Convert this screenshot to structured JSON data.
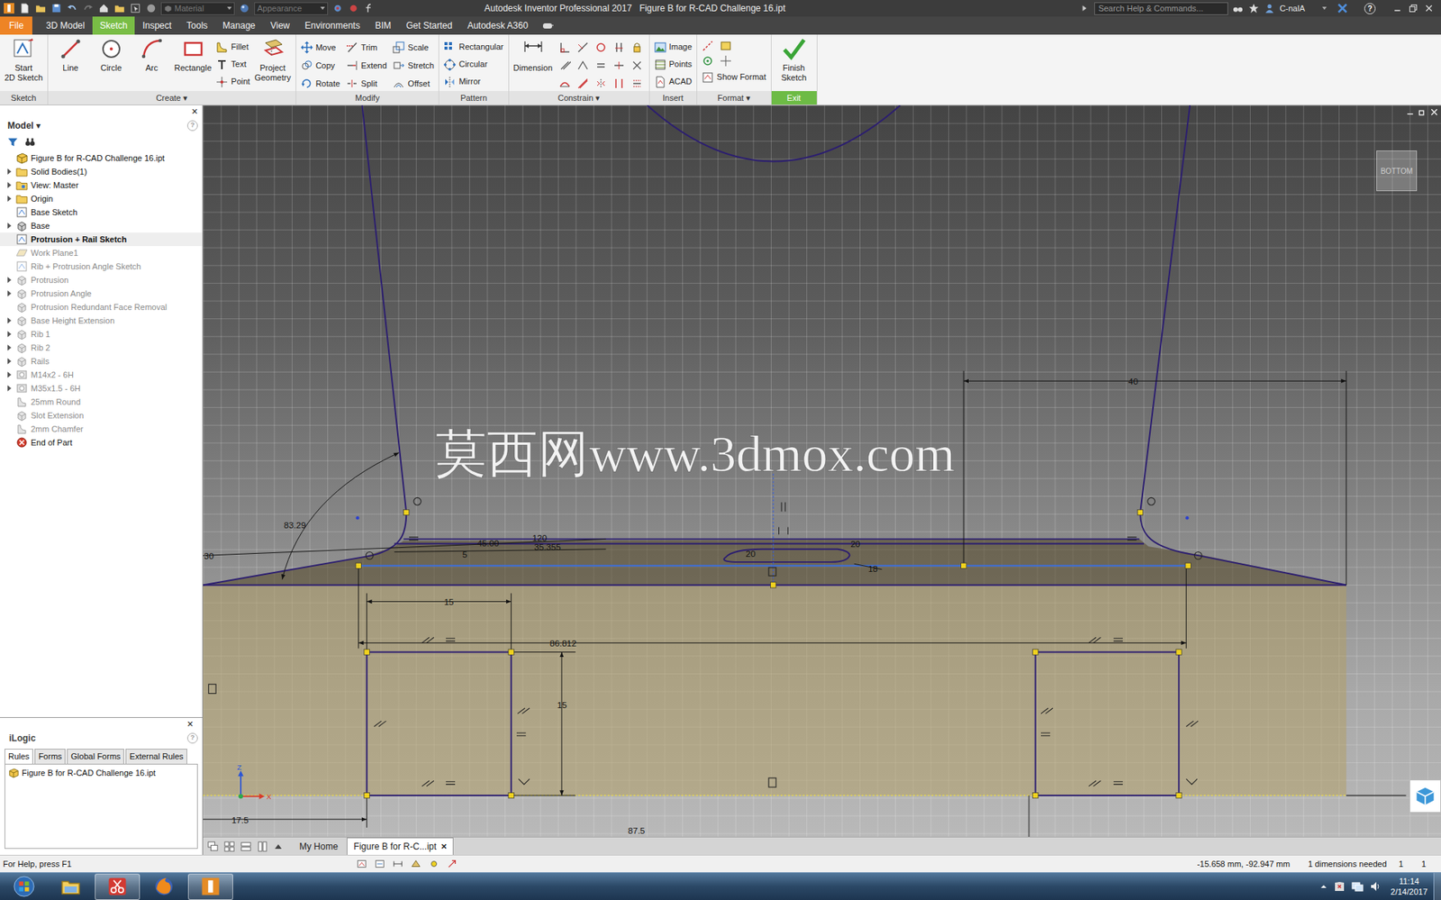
{
  "title_bar": {
    "material": {
      "label": "Material",
      "disabled": true
    },
    "appearance": {
      "label": "Appearance",
      "disabled": true
    },
    "title": "Autodesk Inventor Professional 2017   Figure B for R-CAD Challenge 16.ipt",
    "search": {
      "placeholder": "Search Help & Commands..."
    },
    "user": "C-nalA",
    "help": "?"
  },
  "ribbon_tabs": [
    {
      "label": "File",
      "kind": "file",
      "selected": false
    },
    {
      "label": "3D Model",
      "kind": "tab",
      "selected": false
    },
    {
      "label": "Sketch",
      "kind": "tab",
      "selected": true
    },
    {
      "label": "Inspect",
      "kind": "tab",
      "selected": false
    },
    {
      "label": "Tools",
      "kind": "tab",
      "selected": false
    },
    {
      "label": "Manage",
      "kind": "tab",
      "selected": false
    },
    {
      "label": "View",
      "kind": "tab",
      "selected": false
    },
    {
      "label": "Environments",
      "kind": "tab",
      "selected": false
    },
    {
      "label": "BIM",
      "kind": "tab",
      "selected": false
    },
    {
      "label": "Get Started",
      "kind": "tab",
      "selected": false
    },
    {
      "label": "Autodesk A360",
      "kind": "tab",
      "selected": false
    }
  ],
  "ribbon": {
    "sketch": {
      "label": "Sketch",
      "start": [
        "Start",
        "2D Sketch"
      ]
    },
    "create": {
      "label": "Create ▾",
      "large": [
        "Line",
        "Circle",
        "Arc",
        "Rectangle"
      ],
      "small": [
        "Fillet",
        "Text",
        "Point"
      ],
      "project": [
        "Project",
        "Geometry"
      ]
    },
    "modify": {
      "label": "Modify",
      "tools": [
        "Move",
        "Trim",
        "Scale",
        "Copy",
        "Extend",
        "Stretch",
        "Rotate",
        "Split",
        "Offset"
      ]
    },
    "pattern": {
      "label": "Pattern",
      "tools": [
        "Rectangular",
        "Circular",
        "Mirror"
      ]
    },
    "constrain": {
      "label": "Constrain ▾",
      "dimension": "Dimension"
    },
    "insert": {
      "label": "Insert",
      "tools": [
        "Image",
        "Points",
        "ACAD"
      ]
    },
    "format": {
      "label": "Format ▾",
      "show_format": "Show Format"
    },
    "exit": {
      "label": "Exit",
      "finish": [
        "Finish",
        "Sketch"
      ]
    }
  },
  "browser": {
    "close": "×",
    "title": "Model ▾",
    "help": "?",
    "items": [
      {
        "label": "Figure B for R-CAD Challenge 16.ipt",
        "kind": "part",
        "expandable": false,
        "active": false,
        "dimmed": false
      },
      {
        "label": "Solid Bodies(1)",
        "kind": "folder",
        "expandable": true,
        "active": false,
        "dimmed": false
      },
      {
        "label": "View: Master",
        "kind": "view",
        "expandable": true,
        "active": false,
        "dimmed": false
      },
      {
        "label": "Origin",
        "kind": "folder",
        "expandable": true,
        "active": false,
        "dimmed": false
      },
      {
        "label": "Base Sketch",
        "kind": "sketch",
        "expandable": false,
        "active": false,
        "dimmed": false
      },
      {
        "label": "Base",
        "kind": "feature",
        "expandable": true,
        "active": false,
        "dimmed": false
      },
      {
        "label": "Protrusion + Rail Sketch",
        "kind": "sketch",
        "expandable": false,
        "active": true,
        "dimmed": false
      },
      {
        "label": "Work Plane1",
        "kind": "plane",
        "expandable": false,
        "active": false,
        "dimmed": true
      },
      {
        "label": "Rib + Protrusion Angle Sketch",
        "kind": "sketch",
        "expandable": false,
        "active": false,
        "dimmed": true
      },
      {
        "label": "Protrusion",
        "kind": "feature",
        "expandable": true,
        "active": false,
        "dimmed": true
      },
      {
        "label": "Protrusion Angle",
        "kind": "feature",
        "expandable": true,
        "active": false,
        "dimmed": true
      },
      {
        "label": "Protrusion Redundant Face Removal",
        "kind": "feature",
        "expandable": false,
        "active": false,
        "dimmed": true
      },
      {
        "label": "Base Height Extension",
        "kind": "feature",
        "expandable": true,
        "active": false,
        "dimmed": true
      },
      {
        "label": "Rib 1",
        "kind": "feature",
        "expandable": true,
        "active": false,
        "dimmed": true
      },
      {
        "label": "Rib 2",
        "kind": "feature",
        "expandable": true,
        "active": false,
        "dimmed": true
      },
      {
        "label": "Rails",
        "kind": "feature",
        "expandable": true,
        "active": false,
        "dimmed": true
      },
      {
        "label": "M14x2 - 6H",
        "kind": "hole",
        "expandable": true,
        "active": false,
        "dimmed": true
      },
      {
        "label": "M35x1.5 - 6H",
        "kind": "hole",
        "expandable": true,
        "active": false,
        "dimmed": true
      },
      {
        "label": "25mm Round",
        "kind": "fillet",
        "expandable": false,
        "active": false,
        "dimmed": true
      },
      {
        "label": "Slot Extension",
        "kind": "feature",
        "expandable": false,
        "active": false,
        "dimmed": true
      },
      {
        "label": "2mm Chamfer",
        "kind": "fillet",
        "expandable": false,
        "active": false,
        "dimmed": true
      },
      {
        "label": "End of Part",
        "kind": "end",
        "expandable": false,
        "active": false,
        "dimmed": false
      }
    ]
  },
  "ilogic": {
    "close": "×",
    "title": "iLogic",
    "help": "?",
    "tabs": [
      {
        "label": "Rules",
        "selected": true
      },
      {
        "label": "Forms",
        "selected": false
      },
      {
        "label": "Global Forms",
        "selected": false
      },
      {
        "label": "External Rules",
        "selected": false
      }
    ],
    "rules": [
      "Figure B for R-CAD Challenge 16.ipt"
    ]
  },
  "canvas": {
    "watermark": "莫西网www.3dmox.com",
    "view_cube": "BOTTOM",
    "axis_z": "Z",
    "axis_x": "X",
    "dimensions": [
      "83.29",
      "30",
      "45.00",
      "120",
      "35.355",
      "5",
      "20",
      "20",
      "18",
      "40",
      "15",
      "86.812",
      "15",
      "17.5",
      "87.5"
    ]
  },
  "document_tabs": [
    {
      "label": "My Home",
      "selected": false
    },
    {
      "label": "Figure B for R-C...ipt",
      "selected": true,
      "close": "×"
    }
  ],
  "status_bar": {
    "help": "For Help, press F1",
    "coordinates": "-15.658 mm, -92.947 mm",
    "constraint_status": "1 dimensions needed",
    "counts": [
      "1",
      "1"
    ]
  },
  "taskbar": {
    "apps": [
      {
        "kind": "explorer",
        "selected": false
      },
      {
        "kind": "snipping",
        "selected": true
      },
      {
        "kind": "firefox",
        "selected": false
      },
      {
        "kind": "inventor",
        "selected": true
      }
    ],
    "time": "11:14",
    "date": "2/14/2017"
  }
}
